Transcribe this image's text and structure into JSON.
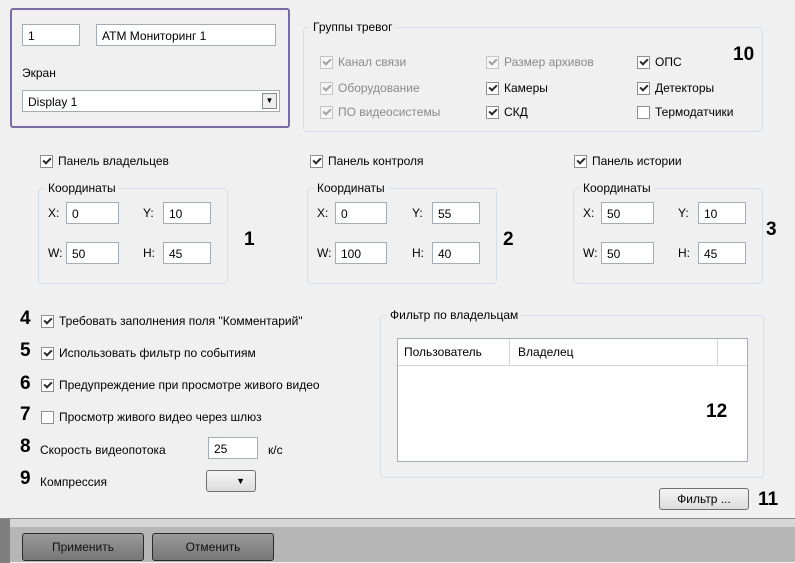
{
  "top_panel": {
    "id_value": "1",
    "name_value": "ATM Мониторинг 1",
    "screen_label": "Экран",
    "screen_value": "Display 1"
  },
  "alarm_groups": {
    "title": "Группы тревог",
    "items": [
      {
        "label": "Канал связи",
        "checked": true,
        "disabled": true
      },
      {
        "label": "Размер архивов",
        "checked": true,
        "disabled": true
      },
      {
        "label": "ОПС",
        "checked": true,
        "disabled": false
      },
      {
        "label": "Оборудование",
        "checked": true,
        "disabled": true
      },
      {
        "label": "Камеры",
        "checked": true,
        "disabled": false
      },
      {
        "label": "Детекторы",
        "checked": true,
        "disabled": false
      },
      {
        "label": "ПО видеосистемы",
        "checked": true,
        "disabled": true
      },
      {
        "label": "СКД",
        "checked": true,
        "disabled": false
      },
      {
        "label": "Термодатчики",
        "checked": false,
        "disabled": false
      }
    ]
  },
  "panels": [
    {
      "label": "Панель владельцев",
      "checked": true,
      "coords_title": "Координаты",
      "x_label": "X:",
      "x": "0",
      "y_label": "Y:",
      "y": "10",
      "w_label": "W:",
      "w": "50",
      "h_label": "H:",
      "h": "45"
    },
    {
      "label": "Панель контроля",
      "checked": true,
      "coords_title": "Координаты",
      "x_label": "X:",
      "x": "0",
      "y_label": "Y:",
      "y": "55",
      "w_label": "W:",
      "w": "100",
      "h_label": "H:",
      "h": "40"
    },
    {
      "label": "Панель истории",
      "checked": true,
      "coords_title": "Координаты",
      "x_label": "X:",
      "x": "50",
      "y_label": "Y:",
      "y": "10",
      "w_label": "W:",
      "w": "50",
      "h_label": "H:",
      "h": "45"
    }
  ],
  "options": [
    {
      "label": "Требовать заполнения поля \"Комментарий\"",
      "checked": true
    },
    {
      "label": "Использовать фильтр по событиям",
      "checked": true
    },
    {
      "label": "Предупреждение при просмотре живого видео",
      "checked": true
    },
    {
      "label": "Просмотр живого видео через шлюз",
      "checked": false
    }
  ],
  "video_speed": {
    "label": "Скорость видеопотока",
    "value": "25",
    "unit": "к/с"
  },
  "compression": {
    "label": "Компрессия",
    "value": ""
  },
  "owner_filter": {
    "title": "Фильтр по владельцам",
    "columns": [
      "Пользователь",
      "Владелец"
    ],
    "rows": []
  },
  "filter_button": "Фильтр ...",
  "footer": {
    "apply": "Применить",
    "cancel": "Отменить"
  },
  "callouts": {
    "n1": "1",
    "n2": "2",
    "n3": "3",
    "n4": "4",
    "n5": "5",
    "n6": "6",
    "n7": "7",
    "n8": "8",
    "n9": "9",
    "n10": "10",
    "n11": "11",
    "n12": "12"
  }
}
